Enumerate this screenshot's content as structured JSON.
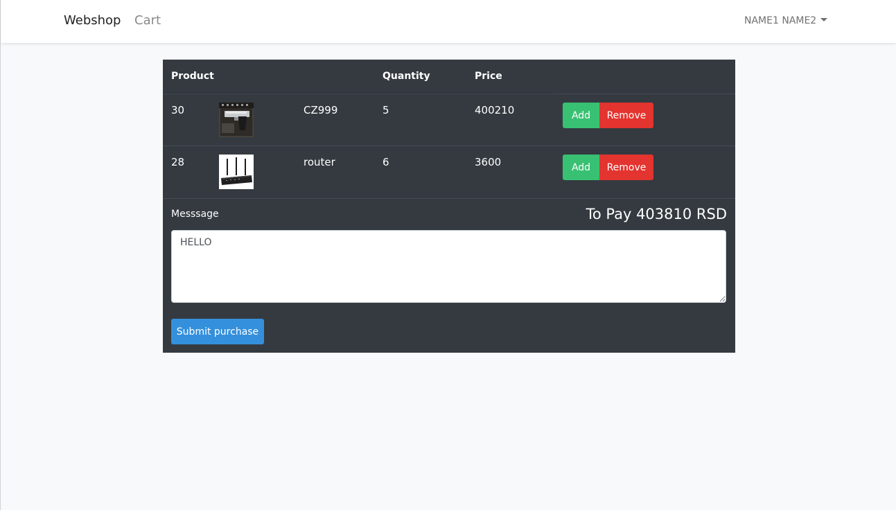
{
  "navbar": {
    "brand": "Webshop",
    "cart": "Cart",
    "user": "NAME1 NAME2"
  },
  "table": {
    "headers": {
      "product": "Product",
      "quantity": "Quantity",
      "price": "Price"
    },
    "rows": [
      {
        "id": "30",
        "name": "CZ999",
        "quantity": "5",
        "price": "400210",
        "add_label": "Add",
        "remove_label": "Remove",
        "image": "pistol-in-case"
      },
      {
        "id": "28",
        "name": "router",
        "quantity": "6",
        "price": "3600",
        "add_label": "Add",
        "remove_label": "Remove",
        "image": "router"
      }
    ]
  },
  "message": {
    "label": "Messsage",
    "value": "HELLO"
  },
  "total": "To Pay 403810 RSD",
  "submit_label": "Submit purchase",
  "colors": {
    "panel": "#343a40",
    "add": "#38c172",
    "remove": "#e3342f",
    "submit": "#3490dc"
  }
}
